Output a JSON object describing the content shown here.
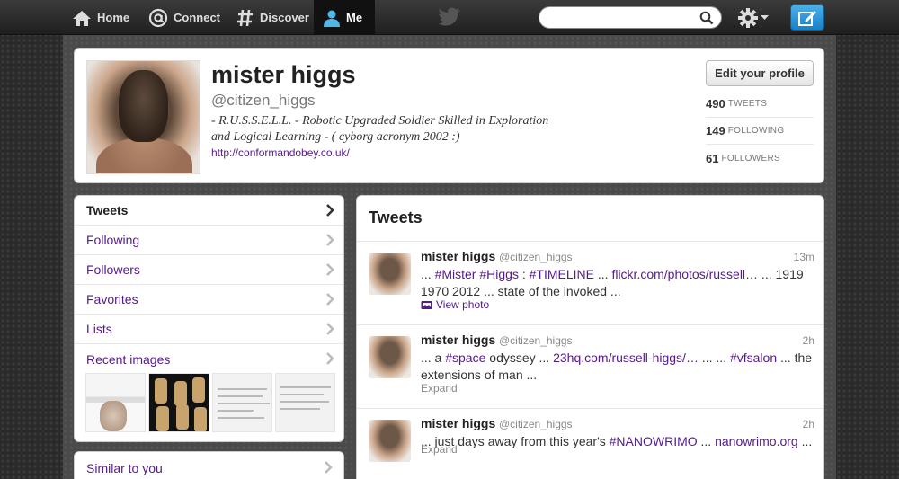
{
  "nav": {
    "home": "Home",
    "connect": "Connect",
    "discover": "Discover",
    "me": "Me"
  },
  "search": {
    "placeholder": "",
    "value": ""
  },
  "colors": {
    "link": "#551a8b",
    "compose": "#1a80c6"
  },
  "profile": {
    "name": "mister higgs",
    "handle": "@citizen_higgs",
    "bio_line1": "- R.U.S.S.E.L.L. - Robotic Upgraded Soldier Skilled in Exploration",
    "bio_line2": "and Logical Learning - ( cyborg acronym 2002 :)",
    "url": "http://conformandobey.co.uk/",
    "edit_label": "Edit your profile",
    "stats": [
      {
        "num": "490",
        "label": "TWEETS"
      },
      {
        "num": "149",
        "label": "FOLLOWING"
      },
      {
        "num": "61",
        "label": "FOLLOWERS"
      }
    ]
  },
  "sidebar": {
    "items": [
      {
        "label": "Tweets"
      },
      {
        "label": "Following"
      },
      {
        "label": "Followers"
      },
      {
        "label": "Favorites"
      },
      {
        "label": "Lists"
      },
      {
        "label": "Recent images"
      }
    ],
    "similar": "Similar to you"
  },
  "tweets": {
    "title": "Tweets",
    "items": [
      {
        "name": "mister higgs",
        "handle": "@citizen_higgs",
        "time": "13m",
        "parts": [
          {
            "t": "... ",
            "link": false
          },
          {
            "t": "#Mister",
            "link": true
          },
          {
            "t": " ",
            "link": false
          },
          {
            "t": "#Higgs",
            "link": true
          },
          {
            "t": " : ",
            "link": false
          },
          {
            "t": "#TIMELINE",
            "link": true
          },
          {
            "t": " ... ",
            "link": false
          },
          {
            "t": "flickr.com/photos/russell…",
            "link": true
          },
          {
            "t": " ... 1919 1970 2012 ... state of the invoked ...",
            "link": false
          }
        ],
        "action": "View photo"
      },
      {
        "name": "mister higgs",
        "handle": "@citizen_higgs",
        "time": "2h",
        "parts": [
          {
            "t": "... a ",
            "link": false
          },
          {
            "t": "#space",
            "link": true
          },
          {
            "t": " odyssey ... ",
            "link": false
          },
          {
            "t": "23hq.com/russell-higgs/…",
            "link": true
          },
          {
            "t": " ... ... ",
            "link": false
          },
          {
            "t": "#vfsalon",
            "link": true
          },
          {
            "t": " ... the extensions of man ...",
            "link": false
          }
        ],
        "action": "Expand"
      },
      {
        "name": "mister higgs",
        "handle": "@citizen_higgs",
        "time": "2h",
        "parts": [
          {
            "t": "... just days away from this year's ",
            "link": false
          },
          {
            "t": "#NANOWRIMO",
            "link": true
          },
          {
            "t": " ... ",
            "link": false
          },
          {
            "t": "nanowrimo.org",
            "link": true
          },
          {
            "t": " ...",
            "link": false
          }
        ],
        "action": "Expand"
      }
    ]
  }
}
